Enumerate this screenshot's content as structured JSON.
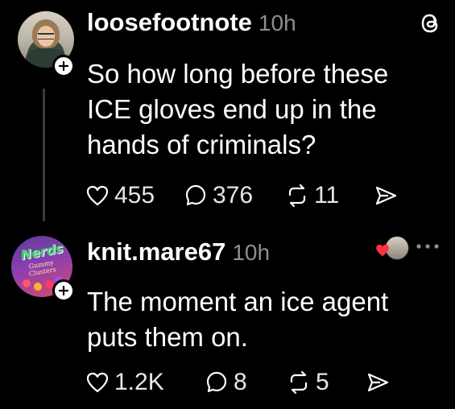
{
  "posts": [
    {
      "username": "loosefootnote",
      "time": "10h",
      "text": "So how long before these\nICE gloves end up in the\nhands of criminals?",
      "likes": "455",
      "replies": "376",
      "reposts": "11",
      "avatar_icon": "woman-portrait-avatar"
    },
    {
      "username": "knit.mare67",
      "time": "10h",
      "text": "The moment an ice agent\nputs them on.",
      "likes": "1.2K",
      "replies": "8",
      "reposts": "5",
      "avatar_icon": "nerds-gummy-clusters-avatar",
      "avatar_logo": "Nerds",
      "avatar_sub": "Gummy\nClusters"
    }
  ],
  "icons": {
    "app": "threads-icon",
    "follow": "plus-icon",
    "like": "heart-icon",
    "reply": "comment-icon",
    "repost": "repost-icon",
    "share": "send-icon",
    "more": "more-icon"
  },
  "colors": {
    "background": "#000000",
    "text": "#ffffff",
    "muted": "#8e8e8e",
    "liked_heart": "#ff3040"
  }
}
